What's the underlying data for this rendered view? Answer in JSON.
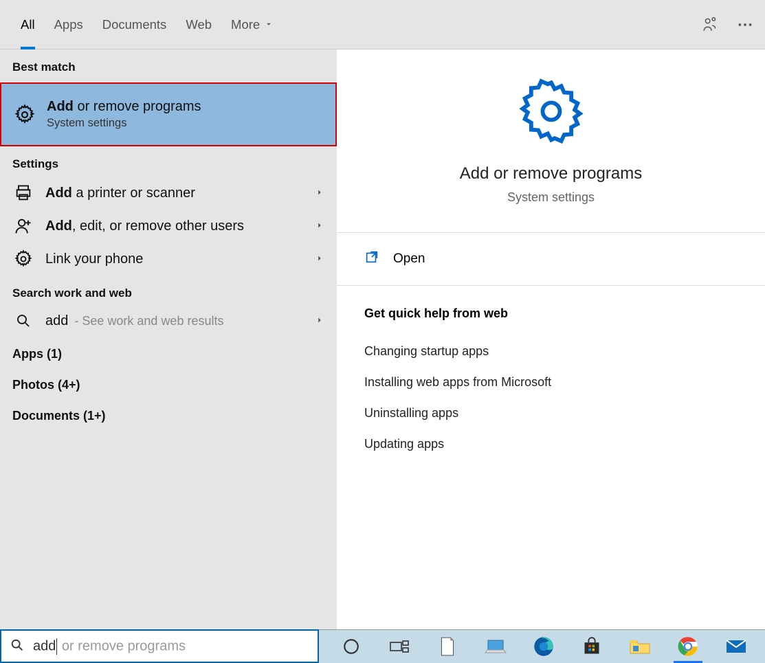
{
  "filters": {
    "all": "All",
    "apps": "Apps",
    "documents": "Documents",
    "web": "Web",
    "more": "More"
  },
  "left": {
    "best_match_header": "Best match",
    "best_match": {
      "title_bold": "Add",
      "title_rest": " or remove programs",
      "sub": "System settings"
    },
    "settings_header": "Settings",
    "settings": [
      {
        "bold": "Add",
        "rest": " a printer or scanner"
      },
      {
        "bold": "Add",
        "rest": ", edit, or remove other users"
      },
      {
        "bold": "",
        "rest": "Link your phone"
      }
    ],
    "search_web_header": "Search work and web",
    "web": {
      "query": "add",
      "hint": " - See work and web results"
    },
    "apps_header": "Apps (1)",
    "photos_header": "Photos (4+)",
    "documents_header": "Documents (1+)"
  },
  "right": {
    "title": "Add or remove programs",
    "sub": "System settings",
    "open": "Open",
    "quick_help_header": "Get quick help from web",
    "links": [
      "Changing startup apps",
      "Installing web apps from Microsoft",
      "Uninstalling apps",
      "Updating apps"
    ]
  },
  "search": {
    "typed": "add",
    "suggestion": " or remove programs"
  },
  "colors": {
    "accent": "#0078d4",
    "highlight_red": "#d30000",
    "best_bg": "#8eb8de"
  }
}
